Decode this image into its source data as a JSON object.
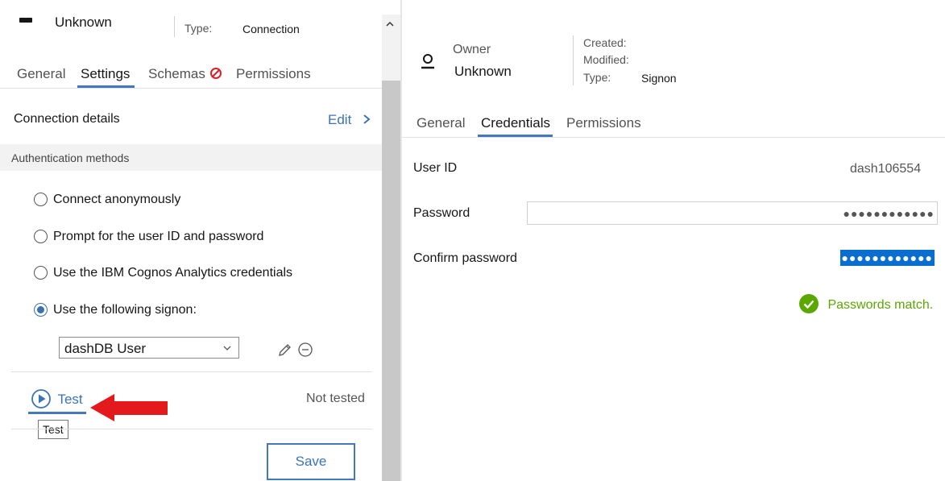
{
  "left": {
    "header": {
      "name": "Unknown",
      "type_label": "Type:",
      "type_value": "Connection"
    },
    "tabs": [
      {
        "label": "General"
      },
      {
        "label": "Settings"
      },
      {
        "label": "Schemas"
      },
      {
        "label": "Permissions"
      }
    ],
    "connection_details": {
      "label": "Connection details",
      "edit_label": "Edit"
    },
    "auth_section": {
      "label": "Authentication methods"
    },
    "auth_options": [
      {
        "label": "Connect anonymously",
        "checked": false
      },
      {
        "label": "Prompt for the user ID and password",
        "checked": false
      },
      {
        "label": "Use the IBM Cognos Analytics credentials",
        "checked": false
      },
      {
        "label": "Use the following signon:",
        "checked": true
      }
    ],
    "signon_select": {
      "value": "dashDB User"
    },
    "test": {
      "label": "Test",
      "status": "Not tested",
      "tooltip": "Test"
    },
    "save_label": "Save"
  },
  "right": {
    "header": {
      "owner_label": "Owner",
      "owner_value": "Unknown",
      "created_label": "Created:",
      "modified_label": "Modified:",
      "type_label": "Type:",
      "type_value": "Signon"
    },
    "tabs": [
      {
        "label": "General"
      },
      {
        "label": "Credentials"
      },
      {
        "label": "Permissions"
      }
    ],
    "fields": {
      "user_id_label": "User ID",
      "user_id_value": "dash106554",
      "password_label": "Password",
      "password_value": "●●●●●●●●●●●●",
      "confirm_label": "Confirm password",
      "confirm_value": "●●●●●●●●●●●●"
    },
    "match_message": "Passwords match."
  },
  "colors": {
    "accent": "#4178be",
    "success": "#5aa700",
    "error": "#da1e28",
    "arrow": "#e3191c"
  }
}
